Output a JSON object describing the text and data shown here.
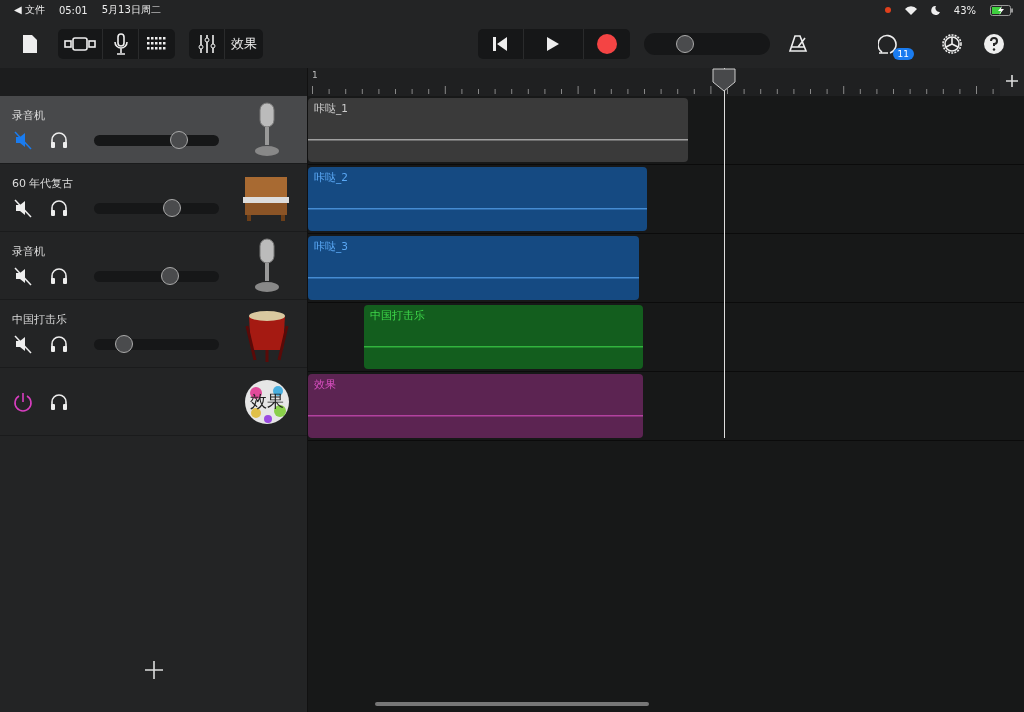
{
  "status_bar": {
    "back": "◀ 文件",
    "time": "05:01",
    "date": "5月13日周二",
    "battery": "43%",
    "recording_dot": true
  },
  "toolbar": {
    "effects_label": "效果",
    "tempo": {
      "level": 0.33
    },
    "notifications_badge": "11"
  },
  "ruler": {
    "bar_label": "1"
  },
  "tracks": [
    {
      "kind": "mic",
      "name": "录音机",
      "selected": true,
      "muted": true,
      "level": 0.68,
      "region": "咔哒_1",
      "color": "#3a3a3a"
    },
    {
      "kind": "piano",
      "name": "60 年代复古",
      "selected": false,
      "muted": false,
      "level": 0.62,
      "region": "咔哒_2",
      "color": "#154a82"
    },
    {
      "kind": "mic",
      "name": "录音机",
      "selected": false,
      "muted": false,
      "level": 0.61,
      "region": "咔哒_3",
      "color": "#154a82"
    },
    {
      "kind": "drum",
      "name": "中国打击乐",
      "selected": false,
      "muted": false,
      "level": 0.24,
      "region": "中国打击乐",
      "color": "#135e1e"
    },
    {
      "kind": "fx",
      "icon_label": "效果",
      "on": true,
      "region": "效果",
      "color": "#5c2452"
    }
  ]
}
